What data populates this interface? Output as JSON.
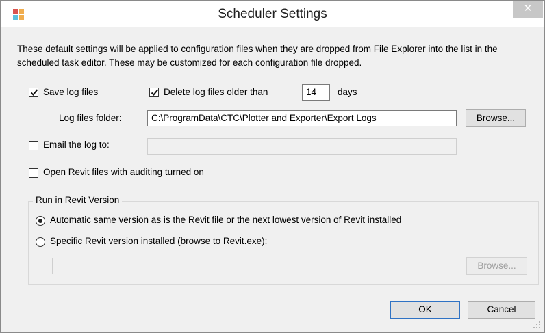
{
  "window": {
    "title": "Scheduler Settings",
    "close_glyph": "✕",
    "app_icon": "app-icon"
  },
  "description": "These default settings will be applied to configuration files when they are dropped from File Explorer into the list in the scheduled task editor.  These may be customized for each configuration file dropped.",
  "log": {
    "save_label": "Save log files",
    "save_checked": true,
    "delete_label": "Delete log files older than",
    "delete_checked": true,
    "days_value": "14",
    "days_label": "days",
    "folder_label": "Log files folder:",
    "folder_value": "C:\\ProgramData\\CTC\\Plotter and Exporter\\Export Logs",
    "browse_label": "Browse..."
  },
  "email": {
    "label": "Email the log to:",
    "checked": false,
    "value": ""
  },
  "audit": {
    "label": "Open Revit files with auditing turned on",
    "checked": false
  },
  "revit_version": {
    "group_title": "Run in Revit Version",
    "automatic_label": "Automatic same version as is the Revit file or the next lowest version of Revit installed",
    "automatic_selected": true,
    "specific_label": "Specific Revit version installed (browse to Revit.exe):",
    "specific_selected": false,
    "path_value": "",
    "browse_label": "Browse..."
  },
  "buttons": {
    "ok_label": "OK",
    "cancel_label": "Cancel"
  }
}
